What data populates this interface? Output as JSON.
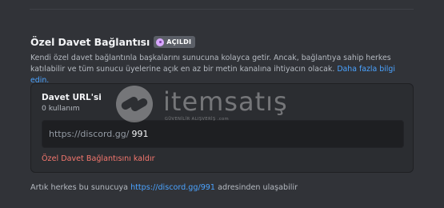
{
  "section": {
    "title": "Özel Davet Bağlantısı",
    "badge": "AÇILDI",
    "description": "Kendi özel davet bağlantınla başkalarını sunucuna kolayca getir. Ancak, bağlantıya sahip herkes katılabilir ve tüm sunucu üyelerine açık en az bir metin kanalına ihtiyacın olacak.",
    "learn_more": "Daha fazla bilgi edin."
  },
  "invite_card": {
    "title": "Davet URL'si",
    "usage": "0 kullanım",
    "url_prefix": "https://discord.gg/",
    "url_code": "991",
    "remove_label": "Özel Davet Bağlantısını kaldır"
  },
  "footer": {
    "prefix": "Artık herkes bu sunucuya",
    "link": "https://discord.gg/991",
    "suffix": "adresinden ulaşabilir"
  },
  "watermark": {
    "brand": "itemsatış",
    "tagline": "GÜVENİLİR ALIŞVERİŞ   .com"
  }
}
